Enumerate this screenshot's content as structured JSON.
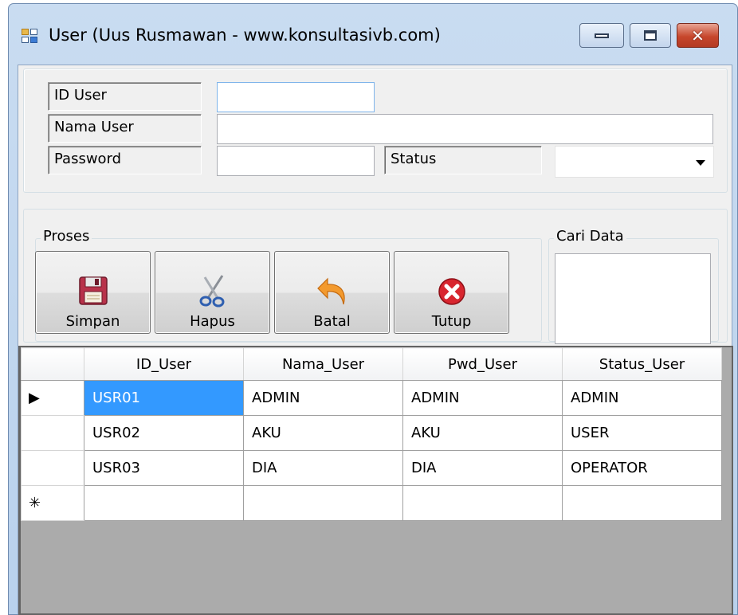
{
  "window": {
    "title": "User (Uus Rusmawan - www.konsultasivb.com)",
    "controls": {
      "minimize": "minimize-icon",
      "maximize": "maximize-icon",
      "close": "close-icon"
    }
  },
  "form": {
    "id_user_label": "ID User",
    "id_user_value": "",
    "nama_user_label": "Nama User",
    "nama_user_value": "",
    "password_label": "Password",
    "password_value": "",
    "status_label": "Status",
    "status_value": ""
  },
  "proses": {
    "group_label": "Proses",
    "buttons": [
      {
        "label": "Simpan",
        "icon": "floppy-disk-icon"
      },
      {
        "label": "Hapus",
        "icon": "scissors-icon"
      },
      {
        "label": "Batal",
        "icon": "undo-arrow-icon"
      },
      {
        "label": "Tutup",
        "icon": "red-x-close-icon"
      }
    ]
  },
  "cari": {
    "group_label": "Cari Data",
    "value": ""
  },
  "grid": {
    "columns": [
      "ID_User",
      "Nama_User",
      "Pwd_User",
      "Status_User"
    ],
    "rows": [
      {
        "indicator": "▶",
        "cells": [
          "USR01",
          "ADMIN",
          "ADMIN",
          "ADMIN"
        ]
      },
      {
        "indicator": "",
        "cells": [
          "USR02",
          "AKU",
          "AKU",
          "USER"
        ]
      },
      {
        "indicator": "",
        "cells": [
          "USR03",
          "DIA",
          "DIA",
          "OPERATOR"
        ]
      },
      {
        "indicator": "✳",
        "cells": [
          "",
          "",
          "",
          ""
        ]
      }
    ],
    "selected_color": "#3399ff"
  }
}
